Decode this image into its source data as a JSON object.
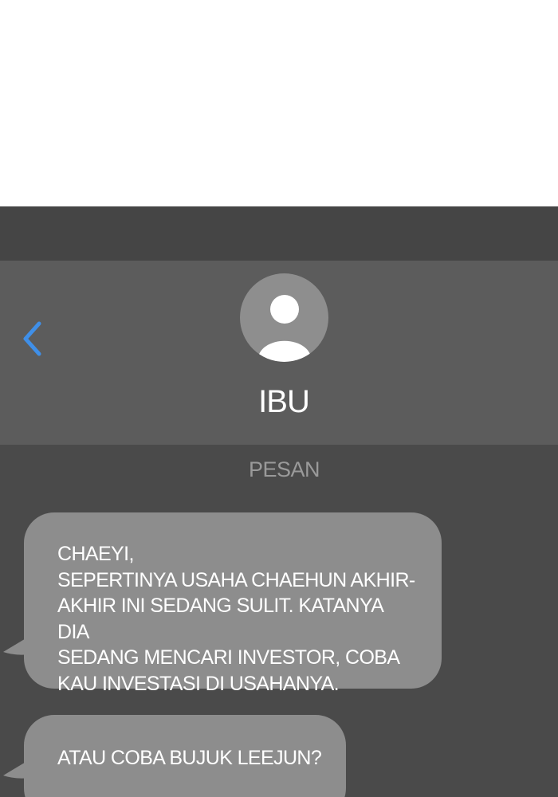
{
  "conversation": {
    "contact_name": "IBU",
    "section_label": "PESAN",
    "messages": [
      {
        "text": "CHAEYI,\nSEPERTINYA USAHA CHAEHUN AKHIR-\nAKHIR INI SEDANG SULIT. KATANYA DIA\nSEDANG MENCARI INVESTOR, COBA\nKAU INVESTASI DI USAHANYA."
      },
      {
        "text": "ATAU COBA BUJUK LEEJUN?"
      }
    ]
  },
  "colors": {
    "background_top": "#ffffff",
    "status_bar": "#454545",
    "header": "#5c5c5c",
    "chat_background": "#4a4a4a",
    "bubble": "#8d8d8d",
    "avatar": "#8e8e8e",
    "back_arrow": "#3f8fe8",
    "section_label": "#9a9a9a"
  },
  "icons": {
    "back": "chevron-left-icon",
    "avatar": "person-icon"
  }
}
